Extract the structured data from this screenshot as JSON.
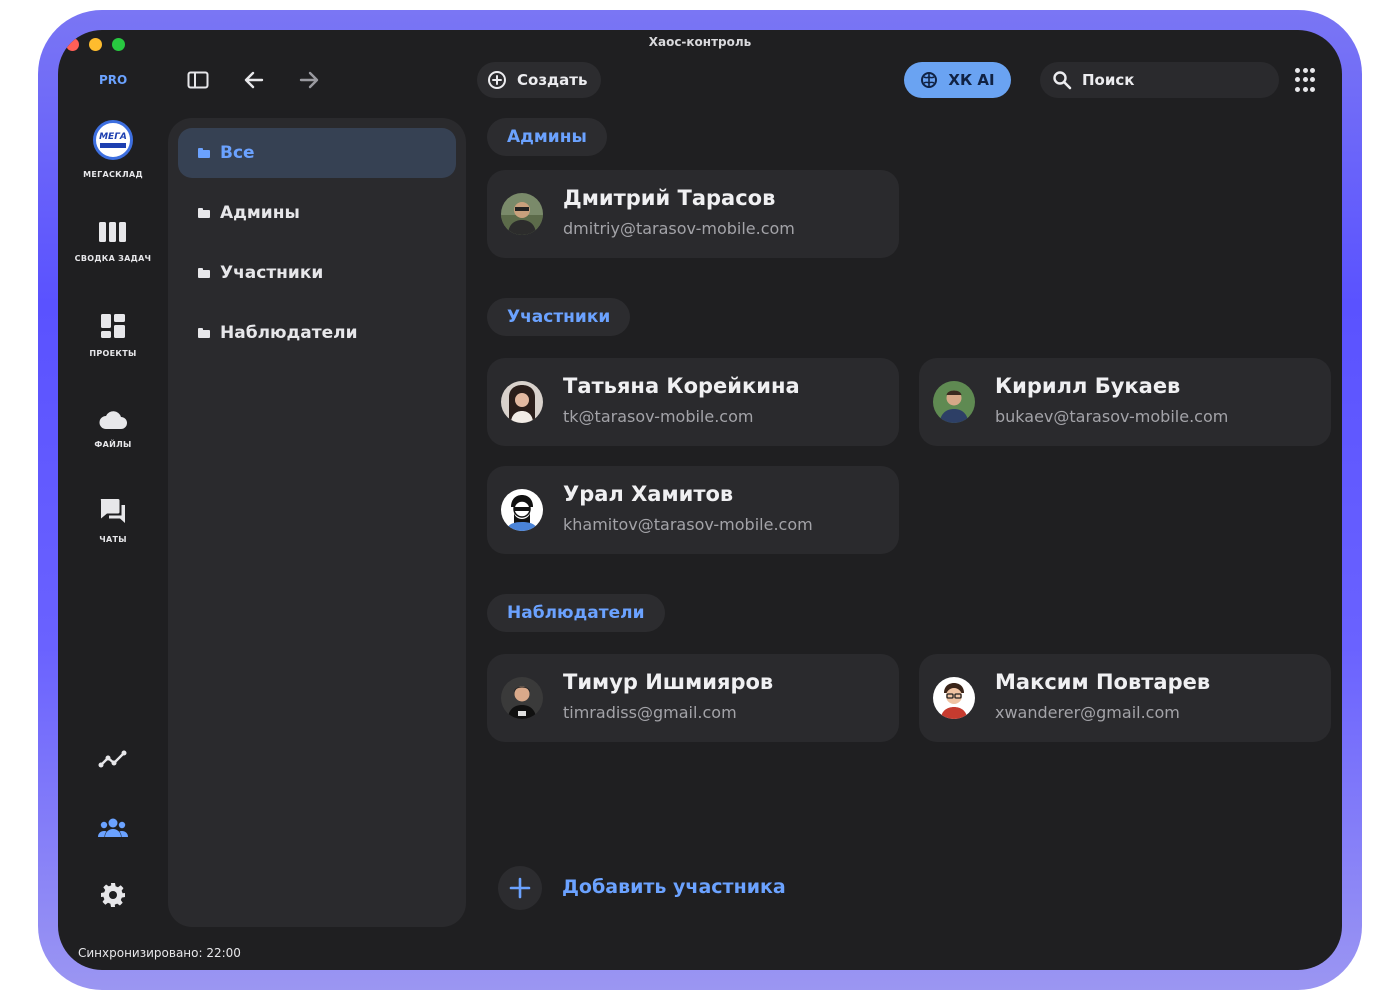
{
  "window": {
    "title": "Хаос-контроль"
  },
  "toolbar": {
    "pro_badge": "PRO",
    "create_label": "Создать",
    "ai_label": "ХК AI",
    "search_placeholder": "Поиск"
  },
  "rail": {
    "workspace_label": "МЕГАСКЛАД",
    "logo_text": "МЕГА",
    "items": [
      {
        "label": "СВОДКА ЗАДАЧ",
        "icon": "columns-icon"
      },
      {
        "label": "ПРОЕКТЫ",
        "icon": "dashboard-icon"
      },
      {
        "label": "ФАЙЛЫ",
        "icon": "cloud-icon"
      },
      {
        "label": "ЧАТЫ",
        "icon": "chat-icon"
      }
    ],
    "bottom": [
      "analytics-icon",
      "team-icon",
      "settings-icon"
    ]
  },
  "sync_status": "Синхронизировано: 22:00",
  "folders": [
    {
      "label": "Все",
      "active": true
    },
    {
      "label": "Админы",
      "active": false
    },
    {
      "label": "Участники",
      "active": false
    },
    {
      "label": "Наблюдатели",
      "active": false
    }
  ],
  "sections": {
    "admins": {
      "title": "Админы",
      "members": [
        {
          "name": "Дмитрий Тарасов",
          "email": "dmitriy@tarasov-mobile.com"
        }
      ]
    },
    "participants": {
      "title": "Участники",
      "members": [
        {
          "name": "Татьяна Корейкина",
          "email": "tk@tarasov-mobile.com"
        },
        {
          "name": "Кирилл Букаев",
          "email": "bukaev@tarasov-mobile.com"
        },
        {
          "name": "Урал Хамитов",
          "email": "khamitov@tarasov-mobile.com"
        }
      ]
    },
    "observers": {
      "title": "Наблюдатели",
      "members": [
        {
          "name": "Тимур Ишмияров",
          "email": "timradiss@gmail.com"
        },
        {
          "name": "Максим Повтарев",
          "email": "xwanderer@gmail.com"
        }
      ]
    }
  },
  "add_member_label": "Добавить участника",
  "colors": {
    "accent": "#6ba2ff",
    "ai_pill": "#6aa3f2",
    "background": "#1f1f21",
    "panel": "#2a2a2d"
  }
}
